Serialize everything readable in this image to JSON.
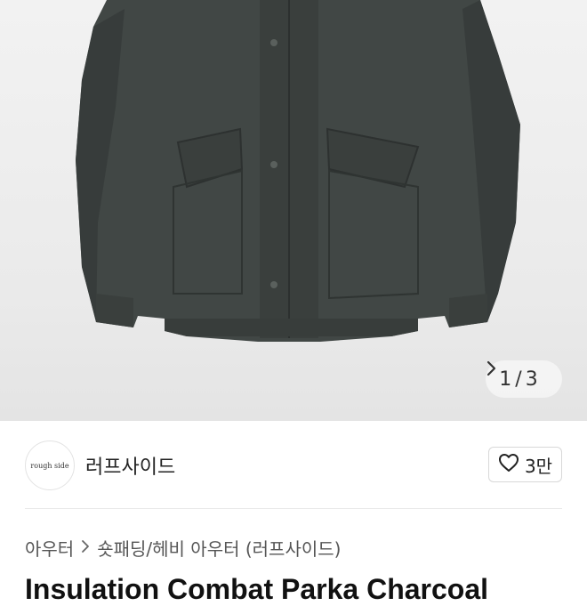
{
  "gallery": {
    "current": "1",
    "separator": "/",
    "total": "3",
    "next_icon": "chevron-right-icon",
    "product_color": "#3e4340"
  },
  "shop": {
    "avatar_text": "rough side",
    "name": "러프사이드",
    "like_icon": "heart-icon",
    "like_count": "3만"
  },
  "breadcrumb": {
    "category": "아우터",
    "separator_icon": "chevron-right-icon",
    "subcategory": "숏패딩/헤비 아우터 (러프사이드)"
  },
  "product": {
    "title": "Insulation Combat Parka Charcoal"
  }
}
